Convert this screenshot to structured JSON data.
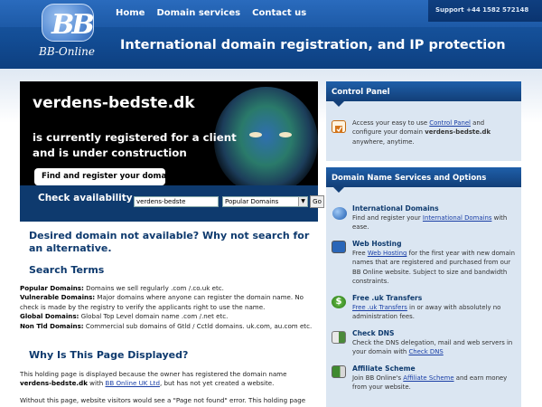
{
  "header": {
    "nav": [
      "Home",
      "Domain services",
      "Contact us"
    ],
    "support": "Support +44 1582 572148",
    "tagline": "International domain registration, and IP protection",
    "logo_text": "BB-Online"
  },
  "hero": {
    "domain": "verdens-bedste.dk",
    "line1": "is currently registered for a client",
    "line2": "and is under construction",
    "pill": "Find and register your domain",
    "avail_label": "Check availability",
    "search_value": "verdens-bedste",
    "select_value": "Popular Domains",
    "go_label": "Go"
  },
  "main": {
    "heading": "Desired domain not available? Why not search for an alternative.",
    "search_terms_heading": "Search Terms",
    "terms": [
      {
        "label": "Popular Domains:",
        "text": " Domains we sell regularly .com /.co.uk etc."
      },
      {
        "label": "Vulnerable Domains:",
        "text": " Major domains where anyone can register the domain name. No check is made by the registry to verify the applicants right to use the name."
      },
      {
        "label": "Global Domains:",
        "text": " Global Top Level domain name .com /.net etc."
      },
      {
        "label": "Non Tld Domains:",
        "text": " Commercial sub domains of Gtld / Cctld domains. uk.com, au.com etc."
      }
    ],
    "why_heading": "Why Is This Page Displayed?",
    "why_p1_a": "This holding page is displayed because the owner has registered the domain name ",
    "why_p1_domain": "verdens-bedste.dk",
    "why_p1_b": " with ",
    "why_p1_link": "BB Online UK Ltd",
    "why_p1_c": ", but has not yet created a website.",
    "why_p2": "Without this page, website visitors would see a \"Page not found\" error. This holding page"
  },
  "control_panel": {
    "title": "Control Panel",
    "text_a": "Access your easy to use ",
    "link": "Control Panel",
    "text_b": " and configure your domain ",
    "domain": "verdens-bedste.dk",
    "text_c": " anywhere, anytime."
  },
  "services": {
    "title": "Domain Name Services and Options",
    "items": [
      {
        "title": "International Domains",
        "a": "Find and register your ",
        "link": "International Domains",
        "b": " with ease."
      },
      {
        "title": "Web Hosting",
        "a": "Free ",
        "link": "Web Hosting",
        "b": " for the first year with new domain names that are registered and purchased from our BB Online website. Subject to size and bandwidth constraints."
      },
      {
        "title": "Free .uk Transfers",
        "a": "",
        "link": "Free .uk Transfers",
        "b": " in or away with absolutely no administration fees."
      },
      {
        "title": "Check DNS",
        "a": "Check the DNS delegation, mail and web servers in your domain with ",
        "link": "Check DNS",
        "b": ""
      },
      {
        "title": "Affiliate Scheme",
        "a": "Join BB Online's ",
        "link": "Affiliate Scheme",
        "b": " and earn money from your website."
      }
    ]
  }
}
